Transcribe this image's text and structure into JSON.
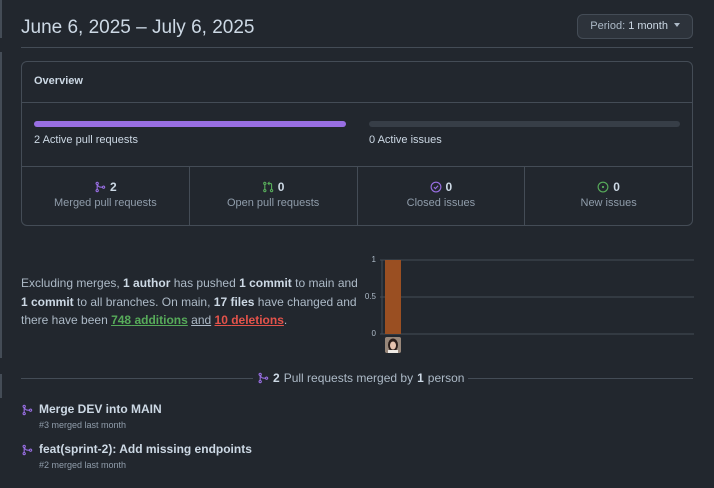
{
  "header": {
    "date_range": "June 6, 2025 – July 6, 2025",
    "period_prefix": "Period:",
    "period_value": "1 month"
  },
  "overview": {
    "title": "Overview",
    "pull_requests_bar": {
      "count": "2",
      "label": "Active pull requests",
      "fill_fraction": 1.0,
      "color": "#986ee2"
    },
    "issues_bar": {
      "count": "0",
      "label": "Active issues",
      "fill_fraction": 0.0
    },
    "stats": [
      {
        "icon": "merge-icon",
        "value": "2",
        "label": "Merged pull requests",
        "color": "#986ee2"
      },
      {
        "icon": "pull-request-icon",
        "value": "0",
        "label": "Open pull requests",
        "color": "#57ab5a"
      },
      {
        "icon": "check-circle-icon",
        "value": "0",
        "label": "Closed issues",
        "color": "#986ee2"
      },
      {
        "icon": "issue-opened-icon",
        "value": "0",
        "label": "New issues",
        "color": "#57ab5a"
      }
    ]
  },
  "summary": {
    "t1": "Excluding merges, ",
    "authors": "1 author",
    "t2": " has pushed ",
    "commits_main": "1 commit",
    "t3": " to main and ",
    "commits_all": "1 commit",
    "t4": " to all branches. On main, ",
    "files": "17 files",
    "t5": " have changed and there have been ",
    "additions_num": "748",
    "additions_word": "additions",
    "t6": "and",
    "deletions_num": "10",
    "deletions_word": "deletions",
    "t7": "."
  },
  "chart_data": {
    "type": "bar",
    "categories": [
      "contributor-1"
    ],
    "values": [
      1
    ],
    "ylim": [
      0,
      1
    ],
    "yticks": [
      "1",
      "0.5",
      "0"
    ],
    "bar_color": "#9a4f22",
    "grid": true
  },
  "merged_section": {
    "count": "2",
    "text_mid": "Pull requests merged by",
    "people": "1",
    "text_end": "person"
  },
  "pull_requests": [
    {
      "title": "Merge DEV into MAIN",
      "meta": "#3 merged last month"
    },
    {
      "title": "feat(sprint-2): Add missing endpoints",
      "meta": "#2 merged last month"
    }
  ],
  "colors": {
    "background": "#22272e",
    "border": "#444c56",
    "merged": "#986ee2",
    "open": "#57ab5a",
    "additions": "#57ab5a",
    "deletions": "#e5534b"
  }
}
